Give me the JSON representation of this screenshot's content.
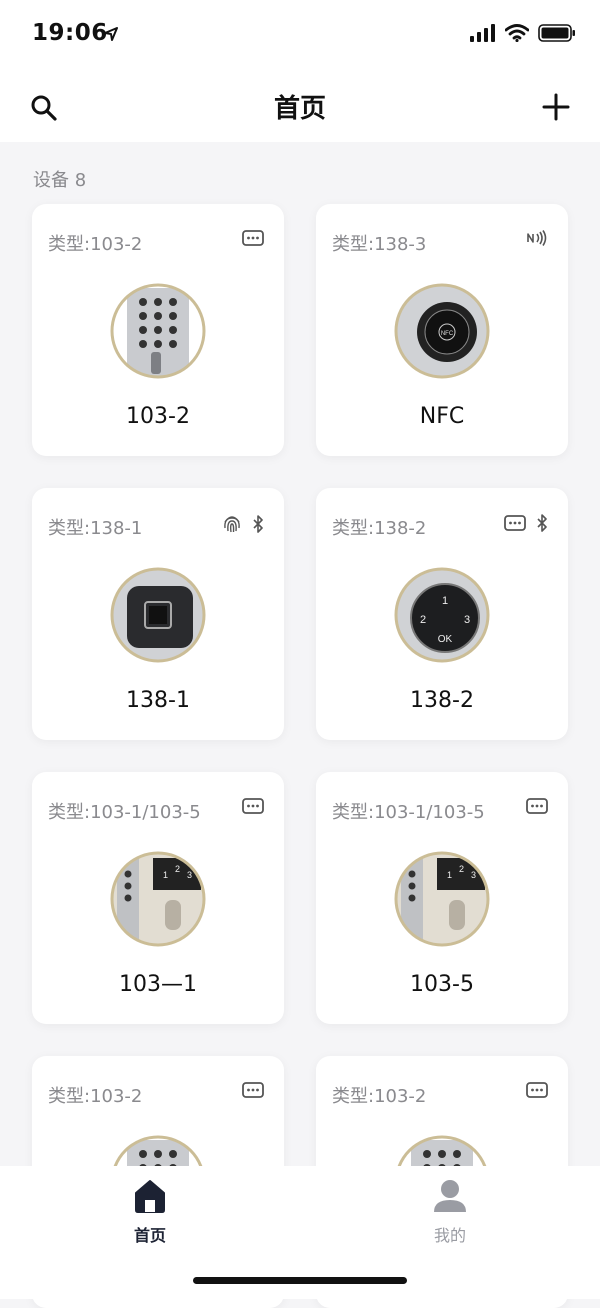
{
  "status_bar": {
    "time": "19:06"
  },
  "nav": {
    "title": "首页",
    "left_icon": "search-icon",
    "right_icon": "plus-icon"
  },
  "section": {
    "title": "设备 8"
  },
  "devices": [
    {
      "type": "类型:103-2",
      "name": "103-2",
      "icons": [
        "keypad-icon"
      ],
      "image": "keypad"
    },
    {
      "type": "类型:138-3",
      "name": "NFC",
      "icons": [
        "nfc-icon"
      ],
      "image": "nfc"
    },
    {
      "type": "类型:138-1",
      "name": "138-1",
      "icons": [
        "fingerprint-icon",
        "bluetooth-icon"
      ],
      "image": "fingerprint"
    },
    {
      "type": "类型:138-2",
      "name": "138-2",
      "icons": [
        "keypad-icon",
        "bluetooth-icon"
      ],
      "image": "dial"
    },
    {
      "type": "类型:103-1/103-5",
      "name": "103—1",
      "icons": [
        "keypad-icon"
      ],
      "image": "handle"
    },
    {
      "type": "类型:103-1/103-5",
      "name": "103-5",
      "icons": [
        "keypad-icon"
      ],
      "image": "handle"
    },
    {
      "type": "类型:103-2",
      "name": "",
      "icons": [
        "keypad-icon"
      ],
      "image": "keypad"
    },
    {
      "type": "类型:103-2",
      "name": "",
      "icons": [
        "keypad-icon"
      ],
      "image": "keypad"
    }
  ],
  "tabs": {
    "home": "首页",
    "me": "我的"
  },
  "device_image_text": {
    "dial_1": "1",
    "dial_2": "2",
    "dial_3": "3",
    "dial_ok": "OK",
    "nfc_label": "NFC"
  },
  "colors": {
    "accent_dark": "#1c2233",
    "tab_inactive": "#9a9ca3",
    "ring": "#cbbd96"
  }
}
